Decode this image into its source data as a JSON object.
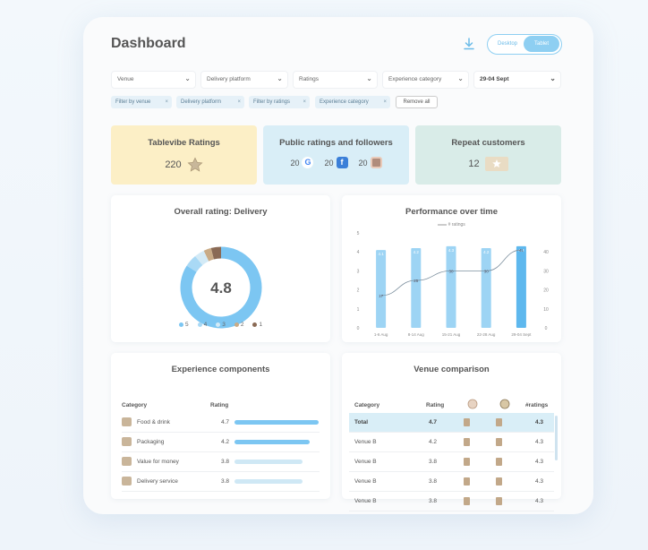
{
  "header": {
    "title": "Dashboard",
    "toggle": [
      "Desktop",
      "Tablet"
    ]
  },
  "filters": [
    "Venue",
    "Delivery platform",
    "Ratings",
    "Experience category",
    "29-04 Sept"
  ],
  "chips": [
    "Filter by venue",
    "Delivery platform",
    "Filter by ratings",
    "Experience category"
  ],
  "remove_all": "Remove all",
  "stats": {
    "tablevibe": {
      "label": "Tablevibe Ratings",
      "value": "220"
    },
    "public": {
      "label": "Public ratings and followers",
      "items": [
        {
          "value": "20",
          "icon": "google-icon"
        },
        {
          "value": "20",
          "icon": "facebook-icon"
        },
        {
          "value": "20",
          "icon": "instagram-icon"
        }
      ]
    },
    "repeat": {
      "label": "Repeat customers",
      "value": "12"
    }
  },
  "overall": {
    "title": "Overall rating: Delivery",
    "score": "4.8",
    "legend": [
      "5",
      "4",
      "3",
      "2",
      "1"
    ],
    "colors": [
      "#7cc6f2",
      "#a9d9f5",
      "#d3eaf6",
      "#c9ab86",
      "#8a6a55"
    ],
    "shares": [
      0.84,
      0.05,
      0.04,
      0.03,
      0.04
    ]
  },
  "performance": {
    "title": "Performance over time",
    "legend": "# ratings"
  },
  "chart_data": {
    "type": "bar",
    "categories": [
      "1-6 Aug",
      "8-14 Aug",
      "15-21 Aug",
      "22-28 Aug",
      "29-04 Sept"
    ],
    "series": [
      {
        "values": [
          4.1,
          4.2,
          4.3,
          4.2,
          4.3
        ]
      },
      {
        "values": [
          17,
          25,
          30,
          30,
          41
        ]
      }
    ],
    "bar_labels": [
      "4.1",
      "4.2",
      "4.3",
      "4.2",
      "4.3"
    ],
    "point_labels": [
      "17",
      "25",
      "30",
      "30",
      "41"
    ],
    "left_ticks": [
      "0",
      "1",
      "2",
      "3",
      "4",
      "5"
    ],
    "right_ticks": [
      "0",
      "10",
      "20",
      "30",
      "40"
    ],
    "ylim_left": [
      0,
      5
    ],
    "ylim_right": [
      0,
      50
    ]
  },
  "experience": {
    "title": "Experience components",
    "headers": [
      "Category",
      "Rating"
    ],
    "rows": [
      {
        "name": "Food & drink",
        "rating": "4.7",
        "level": 0.94
      },
      {
        "name": "Packaging",
        "rating": "4.2",
        "level": 0.84
      },
      {
        "name": "Value for money",
        "rating": "3.8",
        "level": 0.76
      },
      {
        "name": "Delivery service",
        "rating": "3.8",
        "level": 0.76
      }
    ]
  },
  "venue": {
    "title": "Venue comparison",
    "headers": [
      "Category",
      "Rating",
      "#ratings"
    ],
    "rows": [
      {
        "name": "Total",
        "rating": "4.7",
        "count": "4.3"
      },
      {
        "name": "Venue B",
        "rating": "4.2",
        "count": "4.3"
      },
      {
        "name": "Venue B",
        "rating": "3.8",
        "count": "4.3"
      },
      {
        "name": "Venue B",
        "rating": "3.8",
        "count": "4.3"
      },
      {
        "name": "Venue B",
        "rating": "3.8",
        "count": "4.3"
      }
    ]
  }
}
